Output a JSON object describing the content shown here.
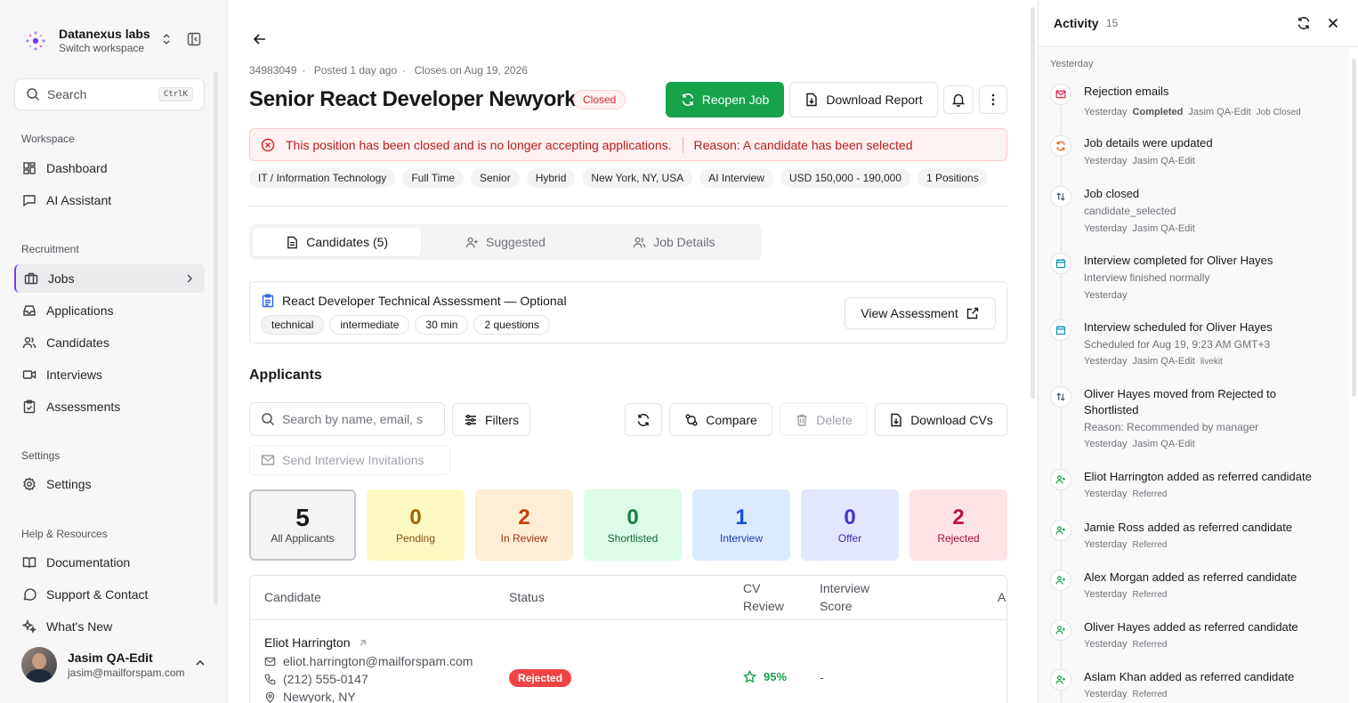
{
  "workspace": {
    "name": "Datanexus labs",
    "subtitle": "Switch workspace"
  },
  "search": {
    "label": "Search",
    "shortcut": "CtrlK"
  },
  "sidebar": {
    "sections": {
      "workspace": "Workspace",
      "recruitment": "Recruitment",
      "settings": "Settings",
      "help": "Help & Resources"
    },
    "items": {
      "dashboard": "Dashboard",
      "ai_assistant": "AI Assistant",
      "jobs": "Jobs",
      "applications": "Applications",
      "candidates": "Candidates",
      "interviews": "Interviews",
      "assessments": "Assessments",
      "settings": "Settings",
      "documentation": "Documentation",
      "support": "Support & Contact",
      "whats_new": "What's New"
    }
  },
  "user": {
    "name": "Jasim QA-Edit",
    "email": "jasim@mailforspam.com"
  },
  "job": {
    "id": "34983049",
    "posted": "Posted 1 day ago",
    "closes": "Closes on Aug 19, 2026",
    "title": "Senior React Developer Newyork",
    "status": "Closed",
    "reopen": "Reopen Job",
    "download_report": "Download Report",
    "alert_msg": "This position has been closed and is no longer accepting applications.",
    "alert_reason": "Reason: A candidate has been selected",
    "tags": [
      "IT / Information Technology",
      "Full Time",
      "Senior",
      "Hybrid",
      "New York, NY, USA",
      "AI Interview",
      "USD 150,000 - 190,000",
      "1 Positions"
    ]
  },
  "tabs": {
    "candidates": "Candidates (5)",
    "suggested": "Suggested",
    "details": "Job Details"
  },
  "assessment": {
    "title": "React Developer Technical Assessment — Optional",
    "chips": [
      "technical",
      "intermediate",
      "30 min",
      "2 questions"
    ],
    "view": "View Assessment"
  },
  "applicants": {
    "heading": "Applicants",
    "search_placeholder": "Search by name, email, s",
    "filters": "Filters",
    "compare": "Compare",
    "delete": "Delete",
    "download_cvs": "Download CVs",
    "send_invites": "Send Interview Invitations"
  },
  "stats": [
    {
      "n": "5",
      "label": "All Applicants"
    },
    {
      "n": "0",
      "label": "Pending"
    },
    {
      "n": "2",
      "label": "In Review"
    },
    {
      "n": "0",
      "label": "Shortlisted"
    },
    {
      "n": "1",
      "label": "Interview"
    },
    {
      "n": "0",
      "label": "Offer"
    },
    {
      "n": "2",
      "label": "Rejected"
    }
  ],
  "table": {
    "headers": {
      "candidate": "Candidate",
      "status": "Status",
      "cv1": "CV",
      "cv2": "Review",
      "score1": "Interview",
      "score2": "Score",
      "actions": "Ac"
    },
    "row": {
      "name": "Eliot Harrington",
      "email": "eliot.harrington@mailforspam.com",
      "phone": "(212) 555-0147",
      "location": "Newyork, NY",
      "status": "Rejected",
      "cv": "95%",
      "score": "-"
    }
  },
  "activity": {
    "title": "Activity",
    "count": "15",
    "group": "Yesterday",
    "events": [
      {
        "title": "Rejection emails",
        "meta": [
          "Yesterday",
          "Completed",
          "Jasim QA-Edit",
          "Job Closed"
        ]
      },
      {
        "title": "Job details were updated",
        "meta": [
          "Yesterday",
          "Jasim QA-Edit"
        ]
      },
      {
        "title": "Job closed",
        "sub": "candidate_selected",
        "meta": [
          "Yesterday",
          "Jasim QA-Edit"
        ]
      },
      {
        "title": "Interview completed for Oliver Hayes",
        "sub": "Interview finished normally",
        "meta": [
          "Yesterday"
        ]
      },
      {
        "title": "Interview scheduled for Oliver Hayes",
        "sub": "Scheduled for Aug 19, 9:23 AM GMT+3",
        "meta": [
          "Yesterday",
          "Jasim QA-Edit",
          "livekit"
        ]
      },
      {
        "title": "Oliver Hayes moved from Rejected to Shortlisted",
        "sub": "Reason: Recommended by manager",
        "meta": [
          "Yesterday",
          "Jasim QA-Edit"
        ]
      },
      {
        "title": "Eliot Harrington added as referred candidate",
        "meta": [
          "Yesterday",
          "Referred"
        ]
      },
      {
        "title": "Jamie Ross added as referred candidate",
        "meta": [
          "Yesterday",
          "Referred"
        ]
      },
      {
        "title": "Alex Morgan added as referred candidate",
        "meta": [
          "Yesterday",
          "Referred"
        ]
      },
      {
        "title": "Oliver Hayes added as referred candidate",
        "meta": [
          "Yesterday",
          "Referred"
        ]
      },
      {
        "title": "Aslam Khan added as referred candidate",
        "meta": [
          "Yesterday",
          "Referred"
        ]
      }
    ]
  },
  "colors": {
    "green": "#16a34a",
    "red": "#dc2626",
    "accent": "#7c3aed"
  }
}
